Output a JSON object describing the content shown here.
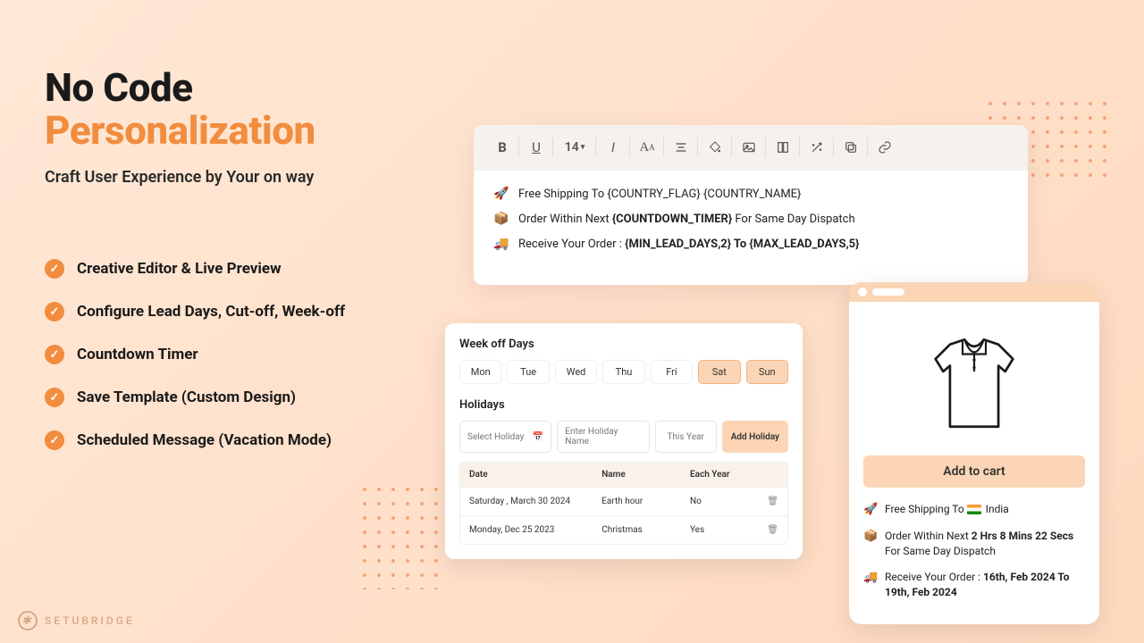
{
  "hero": {
    "title_line1": "No Code",
    "title_line2": "Personalization",
    "subtitle": "Craft User Experience by Your on way"
  },
  "features": [
    "Creative Editor & Live Preview",
    "Configure Lead Days, Cut-off, Week-off",
    "Countdown Timer",
    "Save Template (Custom Design)",
    "Scheduled Message (Vacation Mode)"
  ],
  "toolbar": {
    "font_size": "14"
  },
  "editor_lines": {
    "shipping": "Free Shipping To {COUNTRY_FLAG} {COUNTRY_NAME}",
    "order_pre": "Order Within Next ",
    "order_bold": "{COUNTDOWN_TIMER}",
    "order_post": " For Same Day Dispatch",
    "receive_pre": "Receive Your Order :  ",
    "receive_bold": "{MIN_LEAD_DAYS,2} To  {MAX_LEAD_DAYS,5}"
  },
  "weekoff": {
    "title": "Week off Days",
    "days": [
      {
        "label": "Mon",
        "sel": false
      },
      {
        "label": "Tue",
        "sel": false
      },
      {
        "label": "Wed",
        "sel": false
      },
      {
        "label": "Thu",
        "sel": false
      },
      {
        "label": "Fri",
        "sel": false
      },
      {
        "label": "Sat",
        "sel": true
      },
      {
        "label": "Sun",
        "sel": true
      }
    ],
    "holidays_title": "Holidays",
    "select_placeholder": "Select Holiday",
    "name_placeholder": "Enter Holiday Name",
    "year_placeholder": "This Year",
    "add_button": "Add Holiday",
    "headers": {
      "date": "Date",
      "name": "Name",
      "each": "Each Year"
    },
    "rows": [
      {
        "date": "Saturday , March 30 2024",
        "name": "Earth hour",
        "each": "No"
      },
      {
        "date": "Monday, Dec  25  2023",
        "name": "Christmas",
        "each": "Yes"
      }
    ]
  },
  "preview": {
    "cart": "Add to cart",
    "ship_leading": "Free Shipping To  ",
    "ship_country": "India",
    "order_pre": "Order Within Next ",
    "order_bold": "2 Hrs 8 Mins 22 Secs",
    "order_post": " For Same Day Dispatch",
    "receive_pre": "Receive Your Order :  ",
    "receive_bold": "16th, Feb 2024 To 19th, Feb 2024"
  },
  "brand": "SETUBRIDGE"
}
